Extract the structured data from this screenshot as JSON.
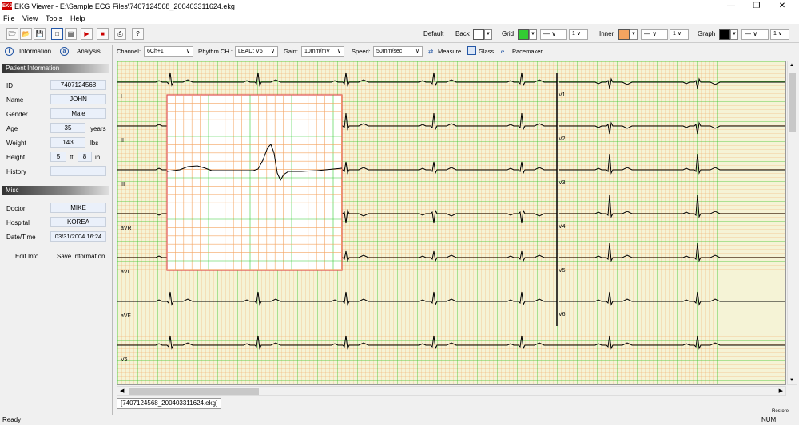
{
  "window": {
    "title": "EKG Viewer - E:\\Sample ECG Files\\7407124568_200403311624.ekg",
    "icon": "ekg-app-icon"
  },
  "menu": [
    "File",
    "View",
    "Tools",
    "Help"
  ],
  "toolbar": {
    "default_label": "Default",
    "back_label": "Back",
    "back_color": "#ffffff",
    "grid_label": "Grid",
    "grid_color": "#33cc33",
    "inner_label": "Inner",
    "inner_color": "#f4a460",
    "graph_label": "Graph",
    "graph_color": "#000000",
    "line_style": "—",
    "line_width": "1"
  },
  "left_panel": {
    "tabs": {
      "information": "Information",
      "analysis": "Analysis"
    },
    "patient_header": "Patient Information",
    "fields": {
      "id_label": "ID",
      "id_value": "7407124568",
      "name_label": "Name",
      "name_value": "JOHN",
      "gender_label": "Gender",
      "gender_value": "Male",
      "age_label": "Age",
      "age_value": "35",
      "age_unit": "years",
      "weight_label": "Weight",
      "weight_value": "143",
      "weight_unit": "lbs",
      "height_label": "Height",
      "height_ft": "5",
      "height_ft_unit": "ft",
      "height_in": "8",
      "height_in_unit": "in",
      "history_label": "History",
      "history_value": ""
    },
    "misc_header": "Misc",
    "misc": {
      "doctor_label": "Doctor",
      "doctor_value": "MIKE",
      "hospital_label": "Hospital",
      "hospital_value": "KOREA",
      "datetime_label": "Date/Time",
      "datetime_value": "03/31/2004 16:24"
    },
    "edit_button": "Edit Info",
    "save_button": "Save Information"
  },
  "ecg_toolbar": {
    "channel_label": "Channel:",
    "channel_value": "6Ch+1",
    "rhythm_label": "Rhythm CH.:",
    "rhythm_value": "LEAD: V6",
    "gain_label": "Gain:",
    "gain_value": "10mm/mV",
    "speed_label": "Speed:",
    "speed_value": "50mm/sec",
    "measure_label": "Measure",
    "glass_label": "Glass",
    "pacemaker_label": "Pacemaker"
  },
  "leads_left": [
    "I",
    "II",
    "III",
    "aVR",
    "aVL",
    "aVF",
    "V6"
  ],
  "leads_right": [
    "V1",
    "V2",
    "V3",
    "V4",
    "V5",
    "V6"
  ],
  "colors": {
    "paper": "#f5f3d6",
    "grid_major": "#33cc33",
    "grid_minor": "#f4a460",
    "trace": "#000000"
  },
  "file_tab": "[7407124568_200403311624.ekg]",
  "status": {
    "left": "Ready",
    "restore": "Restore",
    "num": "NUM"
  }
}
